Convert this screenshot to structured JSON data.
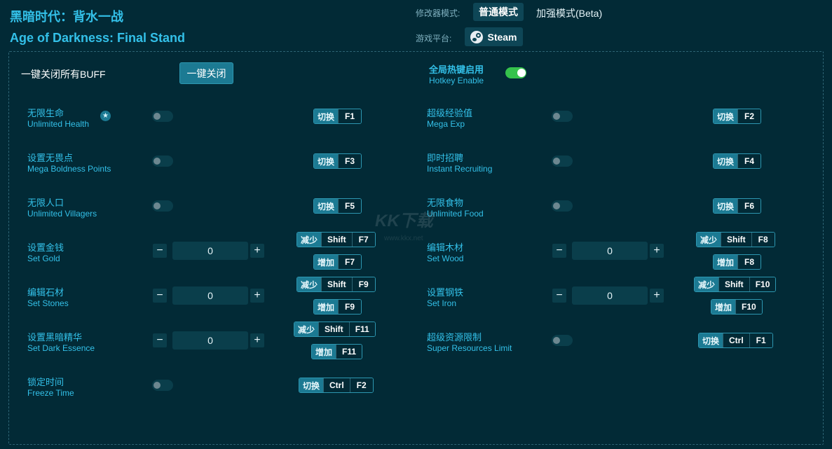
{
  "header": {
    "title_cn": "黑暗时代：背水一战",
    "title_en": "Age of Darkness: Final Stand",
    "mode_label": "修改器模式:",
    "mode_normal": "普通模式",
    "mode_enhanced": "加强模式(Beta)",
    "platform_label": "游戏平台:",
    "platform": "Steam"
  },
  "global": {
    "close_all_label": "一键关闭所有BUFF",
    "close_all_button": "一键关闭",
    "hotkey_cn": "全局热键启用",
    "hotkey_en": "Hotkey Enable",
    "hotkey_enabled": true
  },
  "features": {
    "unlimited_health": {
      "cn": "无限生命",
      "en": "Unlimited Health",
      "tag": "切换",
      "keys": [
        "F1"
      ]
    },
    "mega_exp": {
      "cn": "超级经验值",
      "en": "Mega Exp",
      "tag": "切换",
      "keys": [
        "F2"
      ]
    },
    "mega_boldness": {
      "cn": "设置无畏点",
      "en": "Mega Boldness Points",
      "tag": "切换",
      "keys": [
        "F3"
      ]
    },
    "instant_recruiting": {
      "cn": "即时招聘",
      "en": "Instant Recruiting",
      "tag": "切换",
      "keys": [
        "F4"
      ]
    },
    "unlimited_villagers": {
      "cn": "无限人口",
      "en": "Unlimited Villagers",
      "tag": "切换",
      "keys": [
        "F5"
      ]
    },
    "unlimited_food": {
      "cn": "无限食物",
      "en": "Unlimited Food",
      "tag": "切换",
      "keys": [
        "F6"
      ]
    },
    "set_gold": {
      "cn": "设置金钱",
      "en": "Set Gold",
      "value": "0",
      "dec_tag": "减少",
      "dec_keys": [
        "Shift",
        "F7"
      ],
      "inc_tag": "增加",
      "inc_keys": [
        "F7"
      ]
    },
    "set_wood": {
      "cn": "编辑木材",
      "en": "Set Wood",
      "value": "0",
      "dec_tag": "减少",
      "dec_keys": [
        "Shift",
        "F8"
      ],
      "inc_tag": "增加",
      "inc_keys": [
        "F8"
      ]
    },
    "set_stones": {
      "cn": "编辑石材",
      "en": "Set Stones",
      "value": "0",
      "dec_tag": "减少",
      "dec_keys": [
        "Shift",
        "F9"
      ],
      "inc_tag": "增加",
      "inc_keys": [
        "F9"
      ]
    },
    "set_iron": {
      "cn": "设置钢铁",
      "en": "Set Iron",
      "value": "0",
      "dec_tag": "减少",
      "dec_keys": [
        "Shift",
        "F10"
      ],
      "inc_tag": "增加",
      "inc_keys": [
        "F10"
      ]
    },
    "set_dark_essence": {
      "cn": "设置黑暗精华",
      "en": "Set Dark Essence",
      "value": "0",
      "dec_tag": "减少",
      "dec_keys": [
        "Shift",
        "F11"
      ],
      "inc_tag": "增加",
      "inc_keys": [
        "F11"
      ]
    },
    "super_resources": {
      "cn": "超级资源限制",
      "en": "Super Resources Limit",
      "tag": "切换",
      "keys": [
        "Ctrl",
        "F1"
      ]
    },
    "freeze_time": {
      "cn": "锁定时间",
      "en": "Freeze Time",
      "tag": "切换",
      "keys": [
        "Ctrl",
        "F2"
      ]
    }
  },
  "stepper": {
    "minus": "−",
    "plus": "+"
  },
  "icons": {
    "star": "star-icon",
    "steam": "steam-logo-icon"
  },
  "watermark": {
    "text": "KK下载",
    "url": "www.kkx.net"
  }
}
